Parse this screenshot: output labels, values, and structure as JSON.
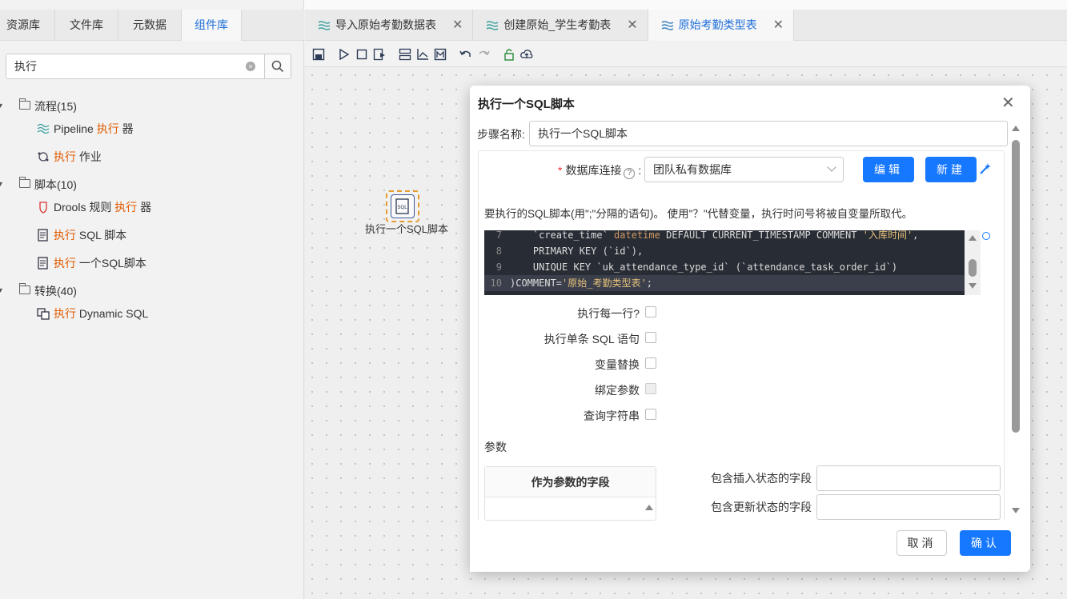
{
  "left_tabs": [
    "资源库",
    "文件库",
    "元数据",
    "组件库"
  ],
  "search": {
    "value": "执行"
  },
  "tree": {
    "groups": [
      {
        "label": "流程(15)"
      },
      {
        "label": "脚本(10)"
      },
      {
        "label": "转换(40)"
      }
    ],
    "leaves": [
      {
        "prefix": "Pipeline ",
        "hl": "执行",
        "suffix": " 器"
      },
      {
        "prefix": "",
        "hl": "执行",
        "suffix": " 作业"
      },
      {
        "prefix": "Drools 规则 ",
        "hl": "执行",
        "suffix": " 器"
      },
      {
        "prefix": "",
        "hl": "执行",
        "suffix": " SQL 脚本"
      },
      {
        "prefix": "",
        "hl": "执行",
        "suffix": " 一个SQL脚本"
      },
      {
        "prefix": "",
        "hl": "执行",
        "suffix": " Dynamic SQL"
      }
    ]
  },
  "editor_tabs": [
    {
      "label": "导入原始考勤数据表"
    },
    {
      "label": "创建原始_学生考勤表"
    },
    {
      "label": "原始考勤类型表"
    }
  ],
  "canvas": {
    "step_label": "执行一个SQL脚本"
  },
  "dialog": {
    "title": "执行一个SQL脚本",
    "step_name_label": "步骤名称:",
    "step_name_value": "执行一个SQL脚本",
    "db_label": "数据库连接",
    "db_value": "团队私有数据库",
    "edit_btn": "编辑",
    "new_btn": "新建",
    "sql_desc": "要执行的SQL脚本(用\";\"分隔的语句)。 使用\"？\"代替变量，执行时问号将被自变量所取代。",
    "code_lines": [
      {
        "num": "7",
        "a": "    `create_time` ",
        "kw": "datetime",
        "b": " DEFAULT CURRENT_TIMESTAMP COMMENT ",
        "str": "'入库时间'",
        "c": ","
      },
      {
        "num": "8",
        "a": "    PRIMARY KEY (`id`),",
        "kw": "",
        "b": "",
        "str": "",
        "c": ""
      },
      {
        "num": "9",
        "a": "    UNIQUE KEY `uk_attendance_type_id` (`attendance_task_order_id`)",
        "kw": "",
        "b": "",
        "str": "",
        "c": ""
      },
      {
        "num": "10",
        "a": ")COMMENT=",
        "kw": "",
        "b": "",
        "str": "'原始_考勤类型表'",
        "c": ";"
      }
    ],
    "options": [
      {
        "label": "执行每一行?"
      },
      {
        "label": "执行单条 SQL 语句"
      },
      {
        "label": "变量替换"
      },
      {
        "label": "绑定参数"
      },
      {
        "label": "查询字符串"
      }
    ],
    "params_label": "参数",
    "params_col": "作为参数的字段",
    "insert_label": "包含插入状态的字段",
    "update_label": "包含更新状态的字段",
    "cancel_btn": "取消",
    "ok_btn": "确认"
  }
}
